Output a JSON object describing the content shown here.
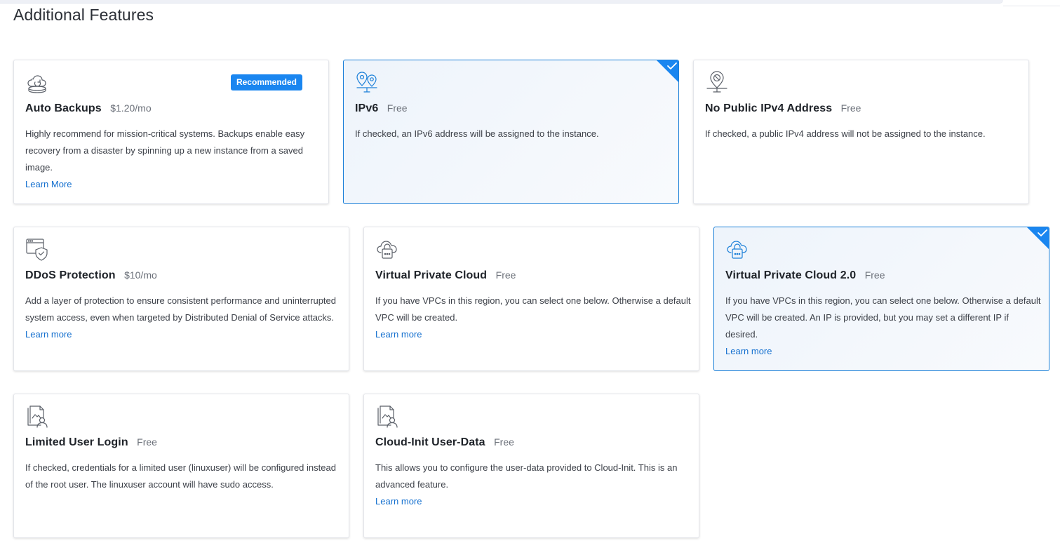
{
  "page": {
    "title": "Additional Features"
  },
  "colors": {
    "accent": "#1a86f0",
    "link": "#1570cf",
    "selected_border": "#1a7fd8"
  },
  "features": [
    {
      "name": "Auto Backups",
      "price": "$1.20/mo",
      "description": "Highly recommend for mission-critical systems. Backups enable easy recovery from a disaster by spinning up a new instance from a saved image.",
      "link": "Learn More",
      "badge": "Recommended",
      "selected": false,
      "icon": "cloud-backup-icon"
    },
    {
      "name": "IPv6",
      "price": "Free",
      "description": "If checked, an IPv6 address will be assigned to the instance.",
      "selected": true,
      "icon": "map-pin-icon"
    },
    {
      "name": "No Public IPv4 Address",
      "price": "Free",
      "description": "If checked, a public IPv4 address will not be assigned to the instance.",
      "selected": false,
      "icon": "blocked-pin-icon"
    },
    {
      "name": "DDoS Protection",
      "price": "$10/mo",
      "description": "Add a layer of protection to ensure consistent performance and uninterrupted system access, even when targeted by Distributed Denial of Service attacks.",
      "link": "Learn more",
      "selected": false,
      "icon": "shield-window-icon"
    },
    {
      "name": "Virtual Private Cloud",
      "price": "Free",
      "description": "If you have VPCs in this region, you can select one below. Otherwise a default VPC will be created.",
      "link": "Learn more",
      "selected": false,
      "icon": "cloud-lock-icon"
    },
    {
      "name": "Virtual Private Cloud 2.0",
      "price": "Free",
      "description": "If you have VPCs in this region, you can select one below. Otherwise a default VPC will be created. An IP is provided, but you may set a different IP if desired.",
      "link": "Learn more",
      "selected": true,
      "icon": "cloud-lock-icon"
    },
    {
      "name": "Limited User Login",
      "price": "Free",
      "description": "If checked, credentials for a limited user (linuxuser) will be configured instead of the root user. The linuxuser account will have sudo access.",
      "selected": false,
      "icon": "user-documents-icon"
    },
    {
      "name": "Cloud-Init User-Data",
      "price": "Free",
      "description": "This allows you to configure the user-data provided to Cloud-Init. This is an advanced feature.",
      "link": "Learn more",
      "selected": false,
      "icon": "user-documents-icon"
    }
  ]
}
